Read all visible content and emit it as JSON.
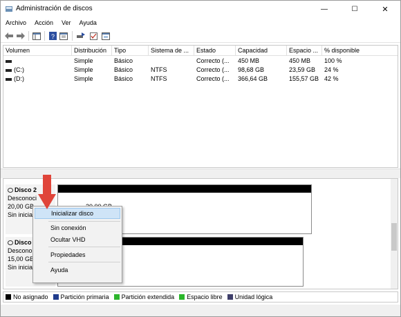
{
  "window": {
    "title": "Administración de discos",
    "controls": [
      "—",
      "☐",
      "✕"
    ]
  },
  "menu": [
    "Archivo",
    "Acción",
    "Ver",
    "Ayuda"
  ],
  "table": {
    "headers": [
      "Volumen",
      "Distribución",
      "Tipo",
      "Sistema de ...",
      "Estado",
      "Capacidad",
      "Espacio ...",
      "% disponible"
    ],
    "rows": [
      [
        "",
        "Simple",
        "Básico",
        "",
        "Correcto (...",
        "450 MB",
        "450 MB",
        "100 %"
      ],
      [
        "(C:)",
        "Simple",
        "Básico",
        "NTFS",
        "Correcto (...",
        "98,68 GB",
        "23,59 GB",
        "24 %"
      ],
      [
        "(D:)",
        "Simple",
        "Básico",
        "NTFS",
        "Correcto (...",
        "366,64 GB",
        "155,57 GB",
        "42 %"
      ]
    ]
  },
  "disks": [
    {
      "name": "Disco 2",
      "status": "Desconoci",
      "size": "20,00 GB",
      "init": "Sin inicia",
      "partition_text": "20,00 GB"
    },
    {
      "name": "Disco",
      "status": "Descono",
      "size": "15,00 GB",
      "init": "Sin inicia",
      "partition_text": ""
    }
  ],
  "context_menu": {
    "items": [
      "Inicializar disco",
      "Sin conexión",
      "Ocultar VHD",
      "Propiedades",
      "Ayuda"
    ],
    "highlighted": "Inicializar disco"
  },
  "legend": [
    {
      "label": "No asignado",
      "color": "#000000"
    },
    {
      "label": "Partición primaria",
      "color": "#1f3b8c"
    },
    {
      "label": "Partición extendida",
      "color": "#2db52d"
    },
    {
      "label": "Espacio libre",
      "color": "#29b629"
    },
    {
      "label": "Unidad lógica",
      "color": "#3f3f6a"
    }
  ],
  "colors": {
    "arrow": "#e0453a",
    "highlight": "#cfe4f7"
  }
}
